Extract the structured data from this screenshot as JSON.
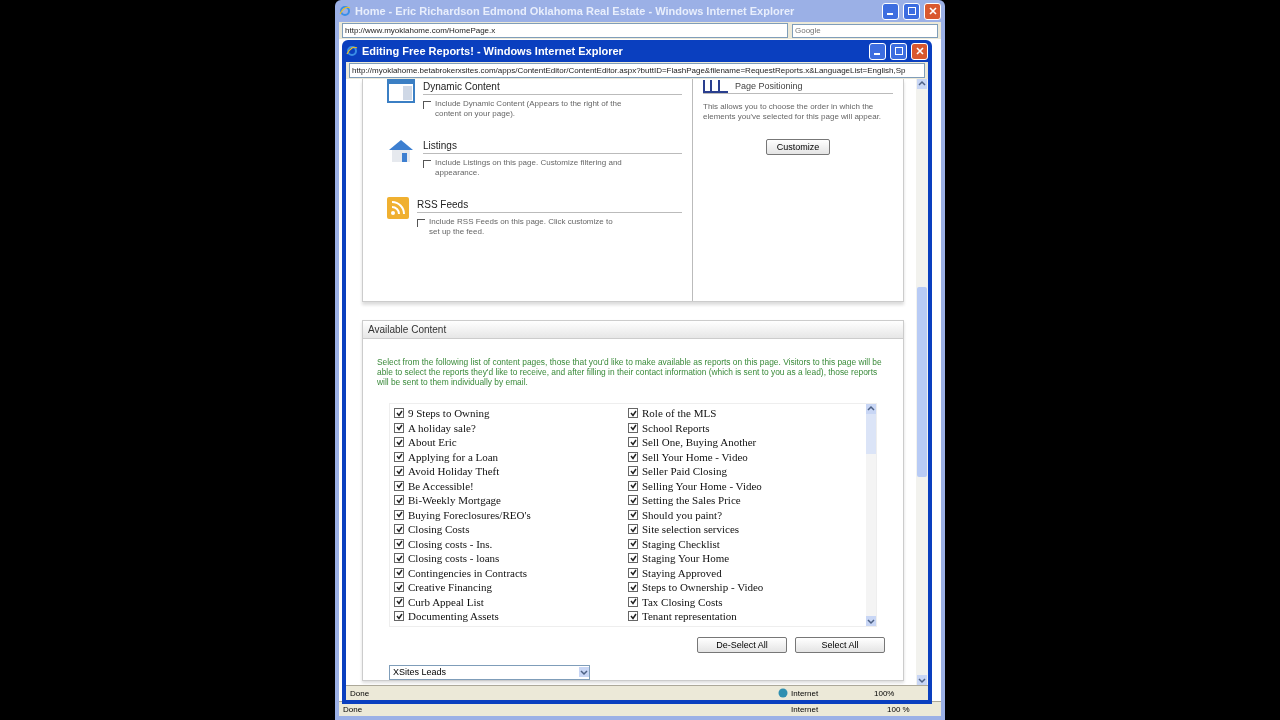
{
  "back_window": {
    "title": "Home - Eric Richardson Edmond Oklahoma Real Estate - Windows Internet Explorer",
    "address": "http://www.myoklahome.com/HomePage.x",
    "search": {
      "placeholder": "Google"
    },
    "status_bar": {
      "text": "Done",
      "zone": "Internet",
      "zoom": "100 %"
    }
  },
  "popup": {
    "title": "Editing Free Reports! - Windows Internet Explorer",
    "address": "http://myoklahome.betabrokerxsites.com/apps/ContentEditor/ContentEditor.aspx?buttID=FlashPage&filename=RequestReports.x&LanguageList=English,Sp",
    "status_bar": {
      "text": "Done",
      "zone": "Internet",
      "zoom": "100%"
    }
  },
  "options": [
    {
      "kind": "dynamic",
      "title": "Dynamic Content",
      "description": "Include Dynamic Content (Appears to the right of the content on your page).",
      "checked": false
    },
    {
      "kind": "listings",
      "title": "Listings",
      "description": "Include Listings on this page. Customize filtering and appearance.",
      "checked": false
    },
    {
      "kind": "rss",
      "title": "RSS Feeds",
      "description": "Include RSS Feeds on this page. Click customize to set up the feed.",
      "checked": false
    }
  ],
  "page_positioning": {
    "title": "Page Positioning",
    "description": "This allows you to choose the order in which the elements you've selected for this page will appear.",
    "button": "Customize"
  },
  "available_content": {
    "title": "Available Content",
    "intro": "Select from the following list of content pages, those that you'd like to make available as reports on this page. Visitors to this page will be able to select the reports they'd like to receive, and after filling in their contact information (which is sent to you as a lead), those reports will be sent to them individually by email.",
    "items": [
      {
        "label": "9 Steps to Owning",
        "checked": true
      },
      {
        "label": "A holiday sale?",
        "checked": true
      },
      {
        "label": "About Eric",
        "checked": true
      },
      {
        "label": "Applying for a Loan",
        "checked": true
      },
      {
        "label": "Avoid Holiday Theft",
        "checked": true
      },
      {
        "label": "Be Accessible!",
        "checked": true
      },
      {
        "label": "Bi-Weekly Mortgage",
        "checked": true
      },
      {
        "label": "Buying Foreclosures/REO's",
        "checked": true
      },
      {
        "label": "Closing Costs",
        "checked": true
      },
      {
        "label": "Closing costs - Ins.",
        "checked": true
      },
      {
        "label": "Closing costs - loans",
        "checked": true
      },
      {
        "label": "Contingencies in Contracts",
        "checked": true
      },
      {
        "label": "Creative Financing",
        "checked": true
      },
      {
        "label": "Curb Appeal List",
        "checked": true
      },
      {
        "label": "Documenting Assets",
        "checked": true
      },
      {
        "label": "Role of the MLS",
        "checked": true
      },
      {
        "label": "School Reports",
        "checked": true
      },
      {
        "label": "Sell One, Buying Another",
        "checked": true
      },
      {
        "label": "Sell Your Home - Video",
        "checked": true
      },
      {
        "label": "Seller Paid Closing",
        "checked": true
      },
      {
        "label": "Selling Your Home - Video",
        "checked": true
      },
      {
        "label": "Setting the Sales Price",
        "checked": true
      },
      {
        "label": "Should you paint?",
        "checked": true
      },
      {
        "label": "Site selection services",
        "checked": true
      },
      {
        "label": "Staging Checklist",
        "checked": true
      },
      {
        "label": "Staging Your Home",
        "checked": true
      },
      {
        "label": "Staying Approved",
        "checked": true
      },
      {
        "label": "Steps to Ownership - Video",
        "checked": true
      },
      {
        "label": "Tax Closing Costs",
        "checked": true
      },
      {
        "label": "Tenant representation",
        "checked": true
      }
    ],
    "buttons": [
      "De-Select All",
      "Select All"
    ],
    "lead_source": {
      "value": "XSites Leads"
    }
  }
}
